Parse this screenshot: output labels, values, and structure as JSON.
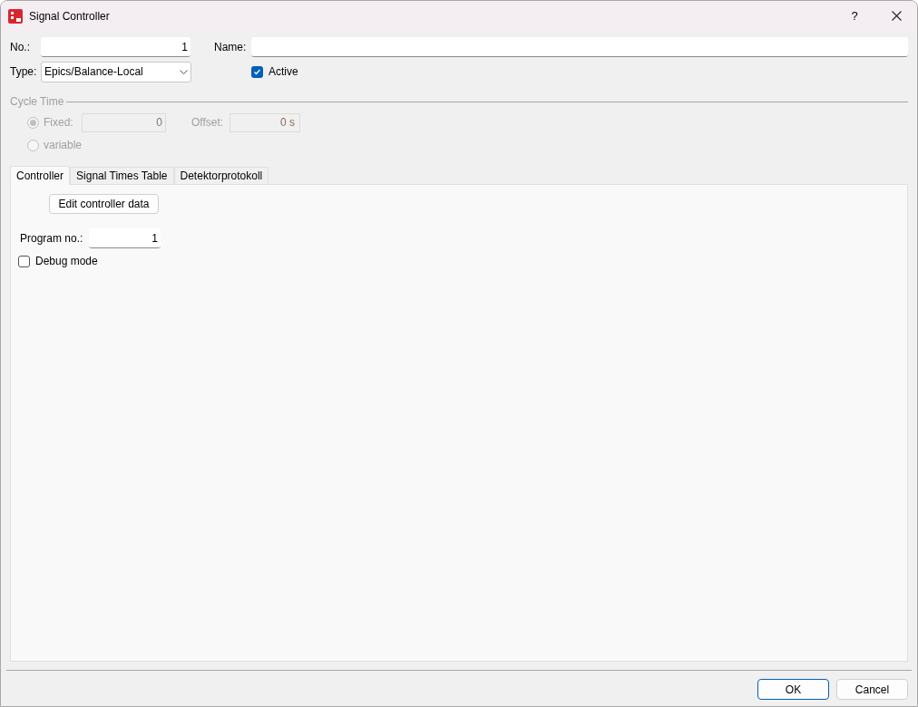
{
  "window": {
    "title": "Signal Controller",
    "help": "?"
  },
  "fields": {
    "number": {
      "label": "No.:",
      "value": "1"
    },
    "name": {
      "label": "Name:"
    },
    "type": {
      "label": "Type:",
      "value": "Epics/Balance-Local"
    },
    "active": {
      "label": "Active",
      "checked": true
    }
  },
  "cycle_time": {
    "title": "Cycle Time",
    "disabled": true,
    "options": [
      {
        "label": "Fixed:",
        "selected": true,
        "value": "0"
      },
      {
        "label": "variable",
        "selected": false
      }
    ],
    "offset": {
      "label": "Offset:",
      "value": "0 s"
    }
  },
  "tabs": [
    {
      "label": "Controller",
      "selected": true
    },
    {
      "label": "Signal Times Table",
      "selected": false
    },
    {
      "label": "Detektorprotokoll",
      "selected": false
    }
  ],
  "controller": {
    "edit_button": "Edit controller data",
    "program": {
      "label": "Program no.:",
      "value": "1"
    },
    "debug": {
      "label": "Debug mode",
      "checked": false
    }
  },
  "buttons": [
    {
      "label": "OK",
      "default": true
    },
    {
      "label": "Cancel",
      "default": false
    }
  ]
}
